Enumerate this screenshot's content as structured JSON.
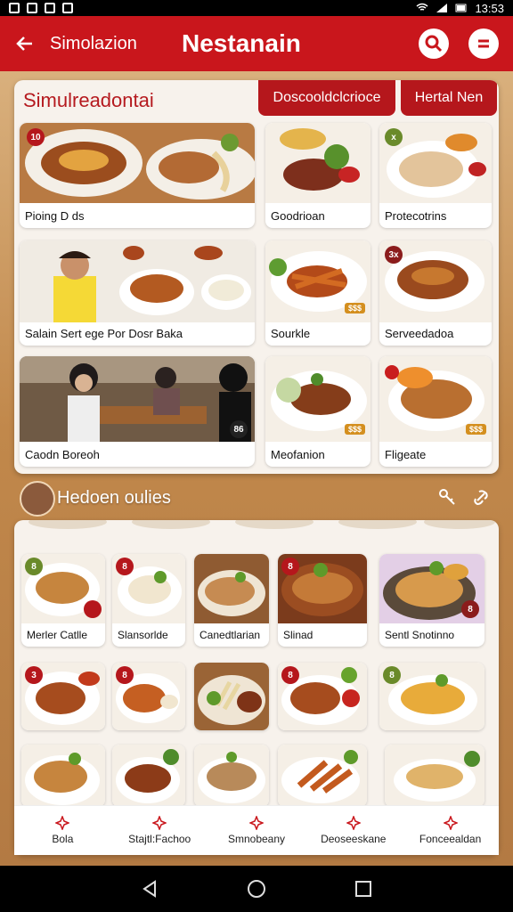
{
  "status": {
    "time": "13:53"
  },
  "app_bar": {
    "subtitle": "Simolazion",
    "title": "Nestanain"
  },
  "top_card": {
    "heading": "Simulreadontai",
    "tabs": [
      "Doscooldclcrioce",
      "Hertal Nen"
    ],
    "tiles": [
      {
        "caption": "Pioing D ds",
        "badge": "10"
      },
      {
        "caption": "Goodrioan",
        "badge": ""
      },
      {
        "caption": "Protecotrins",
        "badge": "x"
      },
      {
        "caption": "Salain Sert ege Por Dosr Baka",
        "badge": ""
      },
      {
        "caption": "Sourkle",
        "badge": "",
        "price": "$$$"
      },
      {
        "caption": "Serveedadoa",
        "badge": "3x"
      },
      {
        "caption": "Caodn Boreoh",
        "badge": "86"
      },
      {
        "caption": "Meofanion",
        "badge": "",
        "price": "$$$"
      },
      {
        "caption": "Fligeate",
        "badge": "",
        "price": "$$$"
      }
    ]
  },
  "middle": {
    "heading": "Hedoen oulies"
  },
  "bottom_card": {
    "tiles": [
      {
        "caption": "Merler Catlle",
        "badge": "8"
      },
      {
        "caption": "Slansorlde",
        "badge": "8"
      },
      {
        "caption": "Canedtlarian",
        "badge": ""
      },
      {
        "caption": "Slinad",
        "badge": "8"
      },
      {
        "caption": "Sentl Snotinno",
        "badge": "8"
      },
      {
        "caption": "",
        "badge": "3"
      },
      {
        "caption": "",
        "badge": "8"
      },
      {
        "caption": "",
        "badge": ""
      },
      {
        "caption": "",
        "badge": "8"
      },
      {
        "caption": "",
        "badge": "8"
      }
    ]
  },
  "bottom_nav": [
    {
      "label": "Bola"
    },
    {
      "label": "Stajtl:Fachoo"
    },
    {
      "label": "Smnobeany"
    },
    {
      "label": "Deoseeskane"
    },
    {
      "label": "Fonceealdan"
    }
  ],
  "colors": {
    "primary": "#c9161c",
    "accent": "#d48f1f",
    "card_bg": "#f7f2ec"
  }
}
